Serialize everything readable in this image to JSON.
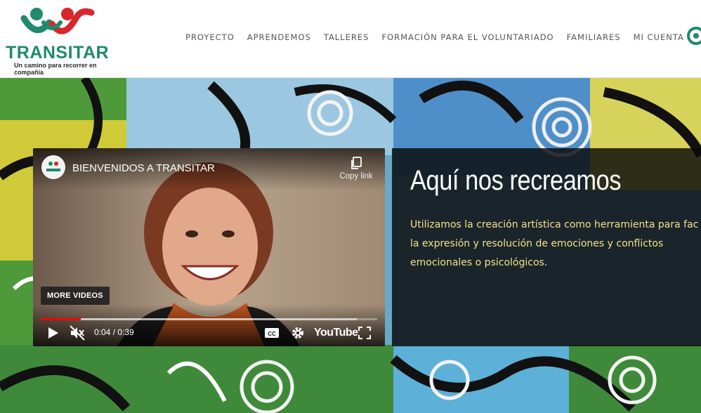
{
  "brand": {
    "name": "TRANSITAR",
    "tagline": "Un camino para recorrer en compañía"
  },
  "nav": {
    "items": [
      "PROYECTO",
      "APRENDEMOS",
      "TALLERES",
      "FORMACIÓN PARA EL VOLUNTARIADO",
      "FAMILIARES",
      "MI CUENTA"
    ]
  },
  "video": {
    "title": "BIENVENIDOS A TRANSITAR",
    "copy_link": "Copy link",
    "more_videos": "MORE VIDEOS",
    "time": "0:04 / 0:39",
    "played_fraction": 0.12,
    "loaded_fraction": 0.94,
    "youtube_label": "YouTube",
    "cc_label": "CC"
  },
  "panel": {
    "heading": "Aquí nos recreamos",
    "lines": [
      "Utilizamos la creación artística como herramienta para fac",
      "la expresión y resolución de emociones y conflictos",
      "emocionales o psicológicos."
    ]
  },
  "colors": {
    "brand_green": "#1f8a6c",
    "brand_red": "#d9262c",
    "panel_text": "#f4e08a",
    "progress_red": "#ff0000"
  }
}
